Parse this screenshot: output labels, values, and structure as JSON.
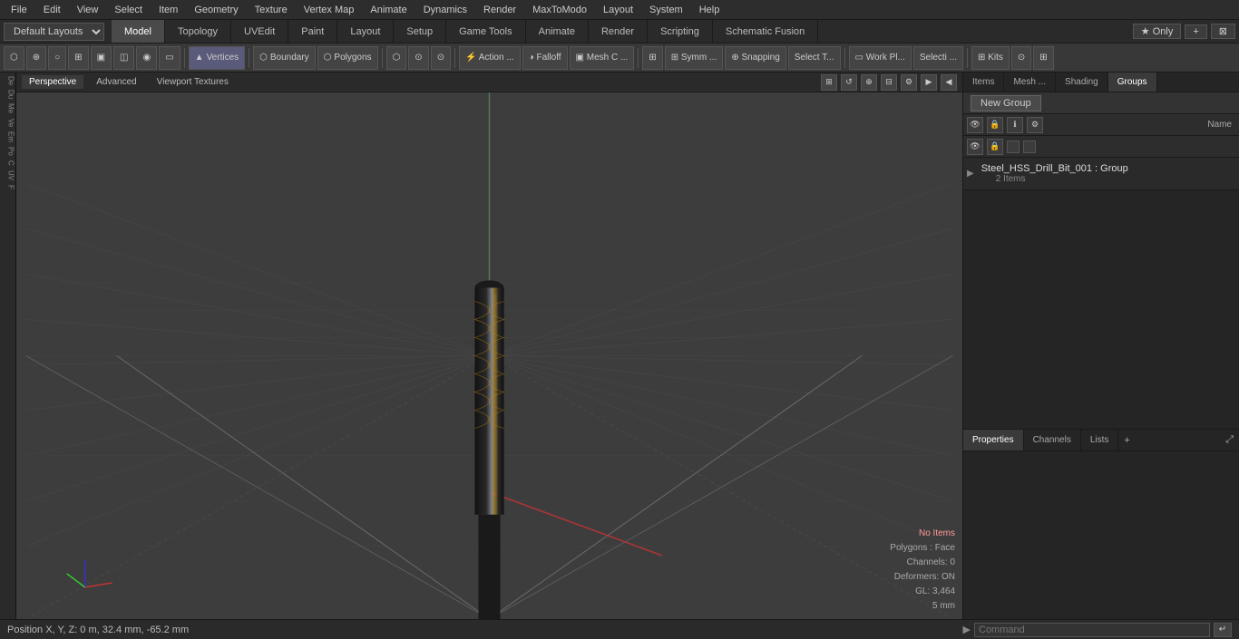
{
  "menu": {
    "items": [
      "File",
      "Edit",
      "View",
      "Select",
      "Item",
      "Geometry",
      "Texture",
      "Vertex Map",
      "Animate",
      "Dynamics",
      "Render",
      "MaxToModo",
      "Layout",
      "System",
      "Help"
    ]
  },
  "layout_bar": {
    "select_label": "Default Layouts ▾",
    "tabs": [
      "Model",
      "Topology",
      "UVEdit",
      "Paint",
      "Layout",
      "Setup",
      "Game Tools",
      "Animate",
      "Render",
      "Scripting",
      "Schematic Fusion"
    ],
    "active_tab": "Model",
    "right_buttons": [
      "★ Only",
      "+",
      "⊠"
    ]
  },
  "tool_bar": {
    "tools": [
      {
        "label": "⬡",
        "name": "grid-btn"
      },
      {
        "label": "⊕",
        "name": "origin-btn"
      },
      {
        "label": "○",
        "name": "circle-btn"
      },
      {
        "label": "⊞",
        "name": "grid2-btn"
      },
      {
        "label": "▣",
        "name": "box-btn"
      },
      {
        "label": "◫",
        "name": "sel-btn"
      },
      {
        "label": "◉",
        "name": "dot-btn"
      },
      {
        "label": "▭",
        "name": "rect-btn"
      },
      {
        "separator": true
      },
      {
        "label": "Vertices",
        "name": "vertices-btn",
        "icon": "▲"
      },
      {
        "separator": true
      },
      {
        "label": "Boundary",
        "name": "boundary-btn",
        "icon": "⬡"
      },
      {
        "label": "Polygons",
        "name": "polygons-btn",
        "icon": "⬡"
      },
      {
        "separator": true
      },
      {
        "label": "⬡",
        "name": "shape-btn"
      },
      {
        "label": "⊙",
        "name": "sphere-btn"
      },
      {
        "label": "⊙",
        "name": "sphere2-btn"
      },
      {
        "separator": true
      },
      {
        "label": "Action ...",
        "name": "action-btn",
        "icon": "⚡"
      },
      {
        "label": "Falloff",
        "name": "falloff-btn",
        "icon": "◑"
      },
      {
        "label": "Mesh C ...",
        "name": "mesh-btn",
        "icon": "▣"
      },
      {
        "separator": true
      },
      {
        "label": "⊞",
        "name": "sym-btn"
      },
      {
        "label": "Symm ...",
        "name": "symm-btn",
        "icon": "⊞"
      },
      {
        "label": "Snapping",
        "name": "snapping-btn",
        "icon": "⊕"
      },
      {
        "label": "Select T...",
        "name": "select-t-btn"
      },
      {
        "separator": true
      },
      {
        "label": "Work Pl...",
        "name": "work-pl-btn",
        "icon": "▭"
      },
      {
        "label": "Selecti ...",
        "name": "selecti-btn"
      },
      {
        "separator": true
      },
      {
        "label": "Kits",
        "name": "kits-btn",
        "icon": "⊞"
      },
      {
        "label": "⊙",
        "name": "view-btn"
      },
      {
        "label": "⊞",
        "name": "layout-btn"
      }
    ]
  },
  "viewport": {
    "tabs": [
      "Perspective",
      "Advanced",
      "Viewport Textures"
    ],
    "active_tab": "Perspective",
    "controls": [
      "⊞",
      "↺",
      "⊕",
      "⊟",
      "⚙",
      "▶",
      "◀"
    ]
  },
  "left_sidebar": {
    "items": [
      "De",
      "Du",
      "Me",
      "Ve",
      "Em",
      "Po",
      "C",
      "UV",
      "F"
    ]
  },
  "status": {
    "position": "Position X, Y, Z:  0 m, 32.4 mm, -65.2 mm",
    "no_items": "No Items",
    "polygons": "Polygons : Face",
    "channels": "Channels: 0",
    "deformers": "Deformers: ON",
    "gl": "GL: 3,464",
    "unit": "5 mm"
  },
  "right_panel": {
    "tabs": [
      "Items",
      "Mesh ...",
      "Shading",
      "Groups"
    ],
    "active_tab": "Groups",
    "new_group_btn": "New Group",
    "column_header": "Name",
    "groups": [
      {
        "name": "Steel_HSS_Drill_Bit_001 : Group",
        "count": "2 Items"
      }
    ]
  },
  "bottom_panel": {
    "tabs": [
      "Properties",
      "Channels",
      "Lists"
    ],
    "active_tab": "Properties",
    "add_btn": "+",
    "expand_btn": "⤢"
  },
  "command_bar": {
    "prompt": "▶",
    "placeholder": "Command",
    "run_btn": "↵"
  }
}
